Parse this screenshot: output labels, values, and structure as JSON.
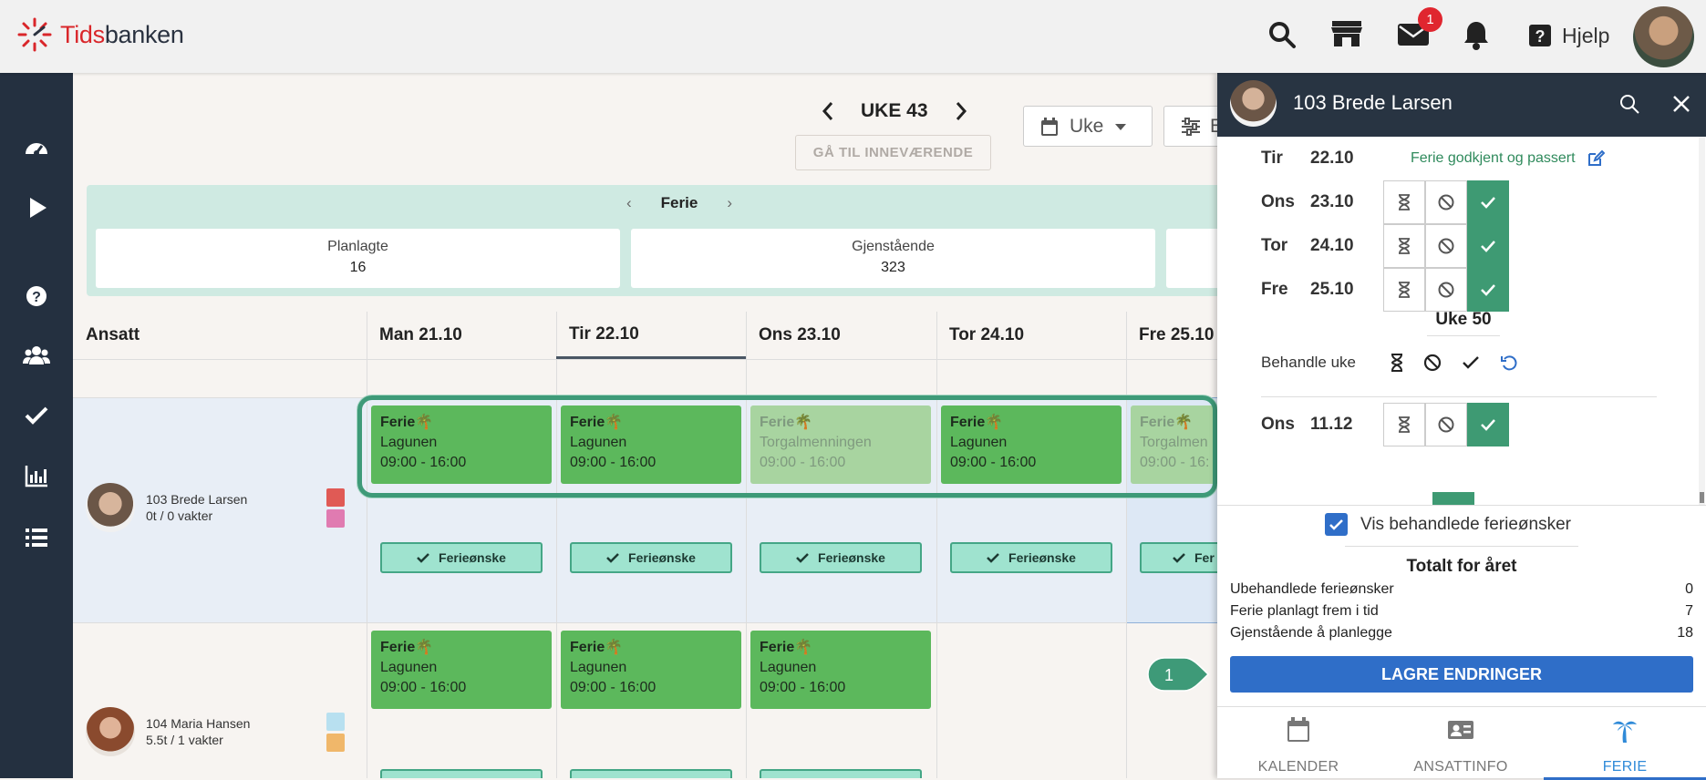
{
  "brand": {
    "name_red": "Tids",
    "name_dark": "banken"
  },
  "topbar": {
    "badge_count": "1",
    "help_label": "Hjelp"
  },
  "nav": {
    "week_label": "UKE 43",
    "goto_label": "GÅ TIL INNEVÆRENDE",
    "view_label": "Uke",
    "filter_label": "E"
  },
  "summary": {
    "title": "Ferie",
    "cards": [
      {
        "label": "Planlagte",
        "value": "16"
      },
      {
        "label": "Gjenstående",
        "value": "323"
      }
    ]
  },
  "grid": {
    "employee_header": "Ansatt",
    "days": [
      "Man 21.10",
      "Tir 22.10",
      "Ons 23.10",
      "Tor 24.10",
      "Fre 25.10"
    ],
    "rows": [
      {
        "name": "103 Brede Larsen",
        "hours": "0t / 0 vakter",
        "colors": [
          "#e05a55",
          "#e07bb1"
        ],
        "shifts": [
          {
            "type": "Ferie🌴",
            "place": "Lagunen",
            "time": "09:00 - 16:00"
          },
          {
            "type": "Ferie🌴",
            "place": "Lagunen",
            "time": "09:00 - 16:00"
          },
          {
            "type": "Ferie🌴",
            "place": "Torgalmenningen",
            "time": "09:00 - 16:00"
          },
          {
            "type": "Ferie🌴",
            "place": "Lagunen",
            "time": "09:00 - 16:00"
          },
          {
            "type": "Ferie🌴",
            "place": "Torgalmen",
            "time": "09:00 - 16:"
          }
        ],
        "wish_label": "Ferieønske",
        "wish_label_cut": "Fer"
      },
      {
        "name": "104 Maria Hansen",
        "hours": "5.5t / 1 vakter",
        "colors": [
          "#b8e0f0",
          "#f0b76a"
        ],
        "shifts": [
          {
            "type": "Ferie🌴",
            "place": "Lagunen",
            "time": "09:00 - 16:00"
          },
          {
            "type": "Ferie🌴",
            "place": "Lagunen",
            "time": "09:00 - 16:00"
          },
          {
            "type": "Ferie🌴",
            "place": "Lagunen",
            "time": "09:00 - 16:00"
          }
        ]
      }
    ]
  },
  "panel": {
    "title": "103 Brede Larsen",
    "first_row": {
      "day": "Tir",
      "date": "22.10",
      "status": "Ferie godkjent og passert"
    },
    "days": [
      {
        "day": "Ons",
        "date": "23.10"
      },
      {
        "day": "Tor",
        "date": "24.10"
      },
      {
        "day": "Fre",
        "date": "25.10"
      }
    ],
    "week_heading": "Uke 50",
    "process_week_label": "Behandle uke",
    "after_row": {
      "day": "Ons",
      "date": "11.12"
    },
    "show_processed_label": "Vis behandlede ferieønsker",
    "totals_title": "Totalt for året",
    "totals": [
      {
        "label": "Ubehandlede ferieønsker",
        "value": "0"
      },
      {
        "label": "Ferie planlagt frem i tid",
        "value": "7"
      },
      {
        "label": "Gjenstående å planlegge",
        "value": "18"
      }
    ],
    "save_label": "LAGRE ENDRINGER",
    "tabs": [
      "KALENDER",
      "ANSATTINFO",
      "FERIE"
    ],
    "active_tab": "FERIE"
  },
  "callout": {
    "number": "1"
  },
  "colors": {
    "green": "#5cb85c",
    "teal": "#3e9a78",
    "primary": "#2f6ec8",
    "dark": "#243040"
  }
}
